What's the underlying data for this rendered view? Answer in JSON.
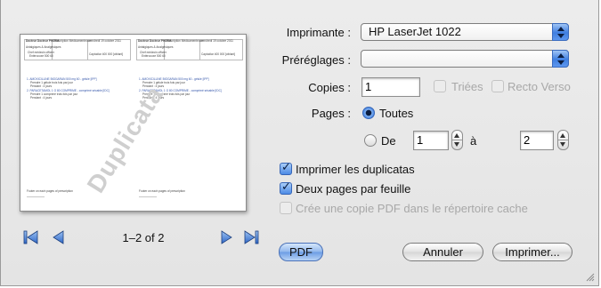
{
  "preview": {
    "watermark": "Duplicata",
    "page_left": {
      "hdr_a": "Docteur Docteur PHLEM",
      "hdr_b": "Prescription Médicamenteuse",
      "hdr_c": "vendredi 19 octobre 2011",
      "hdr_d": "Antalgiques & Analgésiques",
      "hdr_e": "Chef médecin officier",
      "hdr_f": "Entérocoxe 500 60",
      "hdr_g": "Captodiar 400 000 [ciblant]",
      "item1": "1. AMOXICILLINE BIOGARAN 500 mg 60 - gélule [IPP]",
      "item1_sub": "Prendre 1 gélule trois fois par jour",
      "item1_dur": "Pendant : 4 jours",
      "item2": "2. PARACETAMOL 1 G 80 COMPRIME - comprimé sécable [IDC]",
      "item2_sub": "Prendre 1 comprimé trois fois par jour",
      "item2_dur": "Pendant : 4 jours",
      "footer": "Footer on each pages of prescription"
    },
    "page_right": {
      "hdr_a": "Docteur Docteur PHLEM",
      "hdr_b": "Prescription Médicamenteuse",
      "hdr_c": "vendredi 19 octobre 2011",
      "hdr_d": "Antalgiques & Analgésiques",
      "hdr_e": "Chef médecin officier",
      "hdr_f": "Entérocoxe 500 60",
      "hdr_g": "Captodiar 400 000 [ciblant]",
      "item1": "1. AMOXICILLINE BIOGARAN 500 mg 60 - gélule [IPP]",
      "item1_sub": "Prendre 1 gélule trois fois par jour",
      "item1_dur": "Pendant : 4 jours",
      "item2": "2. PARACETAMOL 1 G 80 COMPRIME - comprimé sécable [IDC]",
      "item2_sub": "Prendre 1 comprimé trois fois par jour",
      "item2_dur": "Pendant : 4 jours",
      "footer": "Footer on each pages of prescription"
    }
  },
  "nav": {
    "page_indicator": "1–2 of 2"
  },
  "form": {
    "printer_label": "Imprimante :",
    "printer_value": "HP LaserJet 1022",
    "presets_label": "Préréglages :",
    "presets_value": "",
    "copies_label": "Copies :",
    "copies_value": "1",
    "collated_label": "Triées",
    "duplex_label": "Recto Verso",
    "pages_label": "Pages :",
    "pages_all_label": "Toutes",
    "pages_from_label": "De",
    "pages_from_value": "1",
    "pages_to_label": "à",
    "pages_to_value": "2",
    "print_duplicates_label": "Imprimer les duplicatas",
    "two_per_sheet_label": "Deux pages par feuille",
    "pdf_cache_label": "Crée une copie PDF dans le répertoire cache"
  },
  "buttons": {
    "pdf": "PDF",
    "cancel": "Annuler",
    "print": "Imprimer..."
  },
  "state": {
    "pages_mode": "all",
    "print_duplicates": true,
    "two_per_sheet": true,
    "pdf_cache": false,
    "collated": false,
    "duplex": false
  },
  "colors": {
    "accent_blue": "#3f7ee0",
    "item_text_blue": "#3355aa",
    "watermark_gray": "#cfcfcf"
  }
}
